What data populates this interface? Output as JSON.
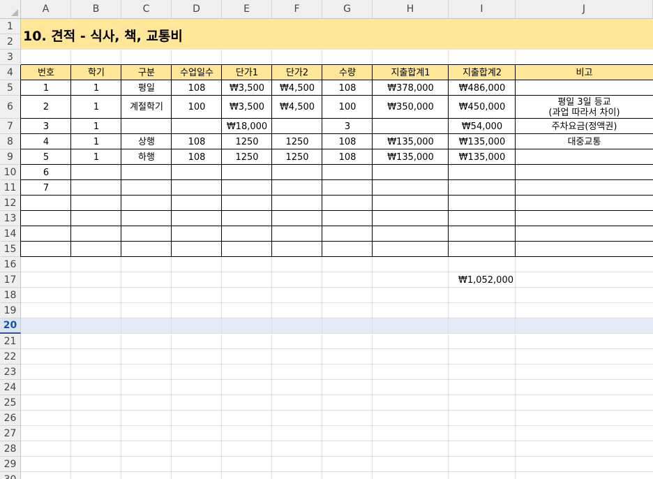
{
  "sheet": {
    "column_headers": [
      "A",
      "B",
      "C",
      "D",
      "E",
      "F",
      "G",
      "H",
      "I",
      "J"
    ],
    "row_headers": [
      "1",
      "2",
      "3",
      "4",
      "5",
      "6",
      "7",
      "8",
      "9",
      "10",
      "11",
      "12",
      "13",
      "14",
      "15",
      "16",
      "17",
      "18",
      "19",
      "20",
      "21",
      "22",
      "23",
      "24",
      "25",
      "26",
      "27",
      "28",
      "29",
      "30"
    ],
    "selected_row": "20",
    "title": "10. 견적 - 식사, 책, 교통비",
    "title_fill": "#ffe699",
    "header_fill": "#ffe699",
    "table_headers": [
      "번호",
      "학기",
      "구분",
      "수업일수",
      "단가1",
      "단가2",
      "수량",
      "지출합계1",
      "지출합계2",
      "비고"
    ],
    "table_rows": [
      [
        "1",
        "1",
        "평일",
        "108",
        "₩3,500",
        "₩4,500",
        "108",
        "₩378,000",
        "₩486,000",
        ""
      ],
      [
        "2",
        "1",
        "계절학기",
        "100",
        "₩3,500",
        "₩4,500",
        "100",
        "₩350,000",
        "₩450,000",
        "평일 3일 등교\n(과업 따라서 차이)"
      ],
      [
        "3",
        "1",
        "",
        "",
        "₩18,000",
        "",
        "3",
        "",
        "₩54,000",
        "주차요금(정액권)"
      ],
      [
        "4",
        "1",
        "상행",
        "108",
        "1250",
        "1250",
        "108",
        "₩135,000",
        "₩135,000",
        "대중교통"
      ],
      [
        "5",
        "1",
        "하행",
        "108",
        "1250",
        "1250",
        "108",
        "₩135,000",
        "₩135,000",
        ""
      ],
      [
        "6",
        "",
        "",
        "",
        "",
        "",
        "",
        "",
        "",
        ""
      ],
      [
        "7",
        "",
        "",
        "",
        "",
        "",
        "",
        "",
        "",
        ""
      ],
      [
        "",
        "",
        "",
        "",
        "",
        "",
        "",
        "",
        "",
        ""
      ],
      [
        "",
        "",
        "",
        "",
        "",
        "",
        "",
        "",
        "",
        ""
      ],
      [
        "",
        "",
        "",
        "",
        "",
        "",
        "",
        "",
        "",
        ""
      ],
      [
        "",
        "",
        "",
        "",
        "",
        "",
        "",
        "",
        "",
        ""
      ]
    ],
    "total": "₩1,052,000"
  }
}
